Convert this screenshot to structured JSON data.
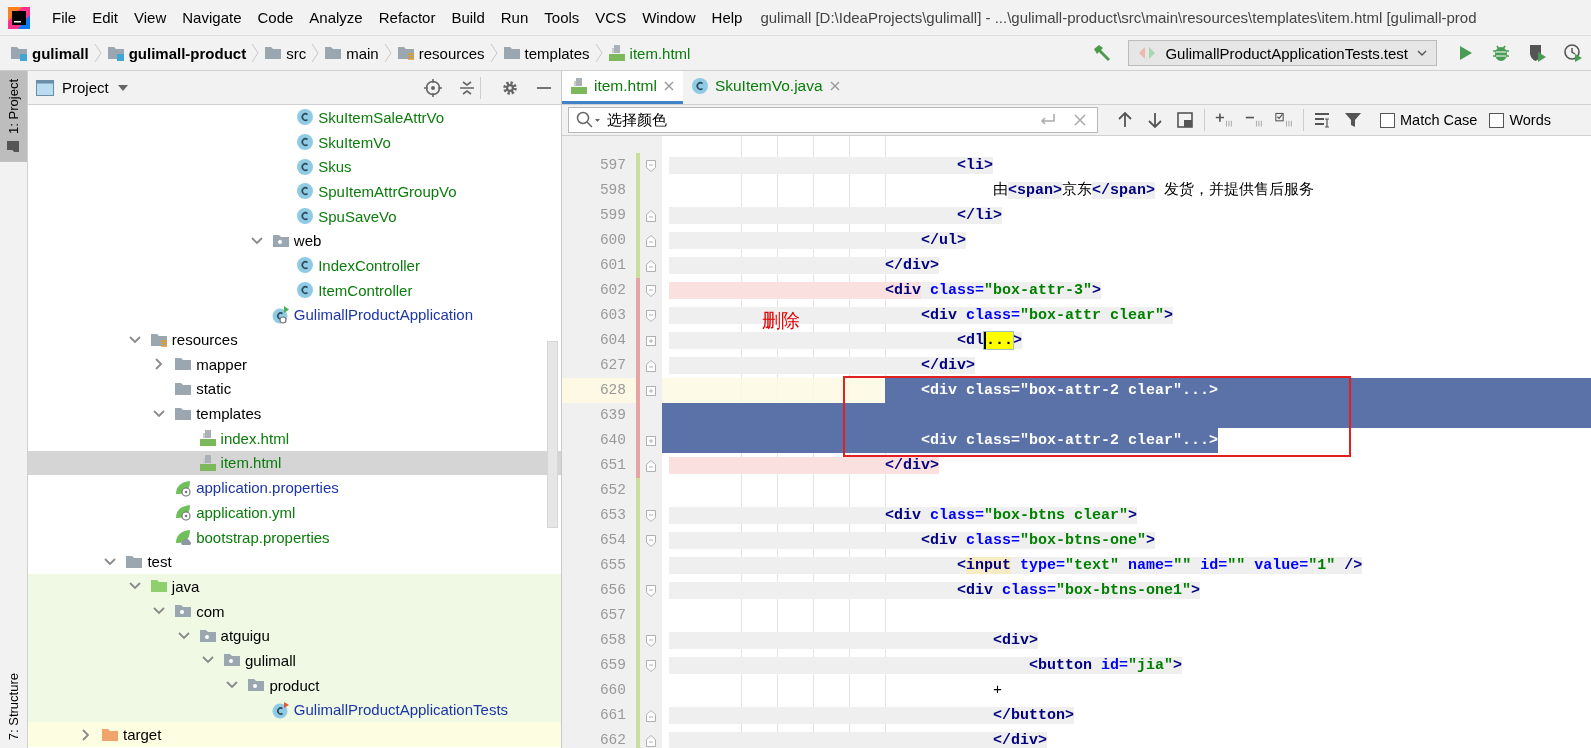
{
  "menu": {
    "items": [
      "File",
      "Edit",
      "View",
      "Navigate",
      "Code",
      "Analyze",
      "Refactor",
      "Build",
      "Run",
      "Tools",
      "VCS",
      "Window",
      "Help"
    ],
    "title": "gulimall [D:\\IdeaProjects\\gulimall] - ...\\gulimall-product\\src\\main\\resources\\templates\\item.html [gulimall-prod"
  },
  "breadcrumb": [
    {
      "label": "gulimall",
      "kind": "module"
    },
    {
      "label": "gulimall-product",
      "kind": "module"
    },
    {
      "label": "src",
      "kind": "folder"
    },
    {
      "label": "main",
      "kind": "folder"
    },
    {
      "label": "resources",
      "kind": "resources"
    },
    {
      "label": "templates",
      "kind": "folder"
    },
    {
      "label": "item.html",
      "kind": "html"
    }
  ],
  "run_config": {
    "label": "GulimallProductApplicationTests.test"
  },
  "side_tabs": [
    {
      "label": "1: Project",
      "selected": true
    },
    {
      "label": "7: Structure",
      "selected": false
    }
  ],
  "project": {
    "title": "Project",
    "tree": [
      {
        "children": [
          {
            "children": [
              {
                "children": [
                  {
                    "children": [
                      {
                        "children": [
                          {
                            "children": [
                              {
                                "children": [
                                  {
                                    "children": [
                                      {
                                        "label": "SkuItemSaleAttrVo",
                                        "kind": "class",
                                        "color": "#0a7c0a",
                                        "selected": false
                                      },
                                      {
                                        "label": "SkuItemVo",
                                        "kind": "class",
                                        "color": "#0a7c0a",
                                        "selected": false
                                      },
                                      {
                                        "label": "Skus",
                                        "kind": "class",
                                        "color": "#0a7c0a",
                                        "selected": false
                                      },
                                      {
                                        "label": "SpuItemAttrGroupVo",
                                        "kind": "class",
                                        "color": "#0a7c0a",
                                        "selected": false
                                      },
                                      {
                                        "label": "SpuSaveVo",
                                        "kind": "class",
                                        "color": "#0a7c0a",
                                        "selected": false
                                      }
                                    ]
                                  },
                                  {
                                    "label": "web",
                                    "kind": "package",
                                    "selected": false,
                                    "expanded": true,
                                    "children": [
                                      {
                                        "label": "IndexController",
                                        "kind": "class",
                                        "color": "#0a7c0a",
                                        "selected": false
                                      },
                                      {
                                        "label": "ItemController",
                                        "kind": "class",
                                        "color": "#0a7c0a",
                                        "selected": false
                                      }
                                    ]
                                  },
                                  {
                                    "label": "GulimallProductApplication",
                                    "kind": "spring-app",
                                    "color": "#1c36a8",
                                    "selected": false
                                  }
                                ]
                              }
                            ]
                          }
                        ]
                      }
                    ]
                  }
                ]
              },
              {
                "label": "resources",
                "kind": "resources",
                "selected": false,
                "expanded": true,
                "children": [
                  {
                    "label": "mapper",
                    "kind": "folder",
                    "selected": false,
                    "expanded": false
                  },
                  {
                    "label": "static",
                    "kind": "folder",
                    "selected": false
                  },
                  {
                    "label": "templates",
                    "kind": "folder",
                    "selected": false,
                    "expanded": true,
                    "children": [
                      {
                        "label": "index.html",
                        "kind": "html",
                        "color": "#0a7c0a",
                        "selected": false
                      },
                      {
                        "label": "item.html",
                        "kind": "html",
                        "color": "#0a7c0a",
                        "selected": true
                      }
                    ]
                  },
                  {
                    "label": "application.properties",
                    "kind": "spring-config",
                    "color": "#1c36a8",
                    "selected": false
                  },
                  {
                    "label": "application.yml",
                    "kind": "spring-config",
                    "color": "#0a7c0a",
                    "selected": false
                  },
                  {
                    "label": "bootstrap.properties",
                    "kind": "spring-cloud",
                    "color": "#0a7c0a",
                    "selected": false
                  }
                ]
              }
            ]
          },
          {
            "label": "test",
            "kind": "folder",
            "selected": false,
            "expanded": true,
            "children": [
              {
                "label": "java",
                "kind": "test-root",
                "selected": false,
                "expanded": true,
                "children": [
                  {
                    "label": "com",
                    "kind": "package",
                    "selected": false,
                    "expanded": true,
                    "children": [
                      {
                        "label": "atguigu",
                        "kind": "package",
                        "selected": false,
                        "expanded": true,
                        "children": [
                          {
                            "label": "gulimall",
                            "kind": "package",
                            "selected": false,
                            "expanded": true,
                            "children": [
                              {
                                "label": "product",
                                "kind": "package",
                                "selected": false,
                                "expanded": true,
                                "children": [
                                  {
                                    "label": "GulimallProductApplicationTests",
                                    "kind": "test-class",
                                    "color": "#1c36a8",
                                    "selected": false
                                  }
                                ]
                              }
                            ]
                          }
                        ]
                      }
                    ]
                  }
                ]
              }
            ]
          }
        ]
      },
      {
        "label": "target",
        "kind": "excluded",
        "selected": false,
        "expanded": false
      }
    ]
  },
  "editor": {
    "tabs": [
      {
        "label": "item.html",
        "kind": "html",
        "selected": true
      },
      {
        "label": "SkuItemVo.java",
        "kind": "class",
        "selected": false
      }
    ],
    "find": {
      "value": "选择颜色",
      "options": [
        {
          "label": "Match Case",
          "checked": false
        },
        {
          "label": "Words",
          "checked": false
        }
      ]
    },
    "annotation": "删除",
    "lines": [
      {
        "number": "597",
        "changed": false,
        "fold": {
          "kind": "start"
        },
        "current": false,
        "caret": false,
        "selected": false,
        "highlighted": true,
        "tokens": [
          {
            "kind": "tag",
            "text": "                                <li>"
          }
        ]
      },
      {
        "number": "598",
        "changed": false,
        "current": false,
        "caret": false,
        "selected": false,
        "highlighted": true,
        "tokens": [
          {
            "kind": "text",
            "text": "                                    由"
          },
          {
            "kind": "tag",
            "text": "<span>"
          },
          {
            "kind": "text",
            "text": "京东"
          },
          {
            "kind": "tag",
            "text": "</span>"
          },
          {
            "kind": "text",
            "text": " 发货，并提供售后服务"
          }
        ]
      },
      {
        "number": "599",
        "changed": false,
        "fold": {
          "kind": "end"
        },
        "current": false,
        "caret": false,
        "selected": false,
        "highlighted": true,
        "tokens": [
          {
            "kind": "tag",
            "text": "                                </li>"
          }
        ]
      },
      {
        "number": "600",
        "changed": false,
        "fold": {
          "kind": "end"
        },
        "current": false,
        "caret": false,
        "selected": false,
        "highlighted": true,
        "tokens": [
          {
            "kind": "tag",
            "text": "                            </ul>"
          }
        ]
      },
      {
        "number": "601",
        "changed": false,
        "fold": {
          "kind": "end"
        },
        "current": false,
        "caret": false,
        "selected": false,
        "highlighted": true,
        "tokens": [
          {
            "kind": "tag",
            "text": "                        </div>"
          }
        ]
      },
      {
        "number": "602",
        "changed": true,
        "fold": {
          "kind": "start"
        },
        "current": false,
        "caret": false,
        "selected": false,
        "highlighted": true,
        "tokens": [
          {
            "kind": "matched-tag",
            "text": "                        <div"
          },
          {
            "kind": "attr",
            "text": " class="
          },
          {
            "kind": "value",
            "text": "\"box-attr-3\""
          },
          {
            "kind": "tag",
            "text": ">"
          }
        ]
      },
      {
        "number": "603",
        "changed": true,
        "fold": {
          "kind": "start"
        },
        "current": false,
        "caret": false,
        "selected": false,
        "highlighted": true,
        "tokens": [
          {
            "kind": "tag",
            "text": "                            <div"
          },
          {
            "kind": "attr",
            "text": " class="
          },
          {
            "kind": "value",
            "text": "\"box-attr clear\""
          },
          {
            "kind": "tag",
            "text": ">"
          }
        ]
      },
      {
        "number": "604",
        "changed": true,
        "fold": {
          "kind": "collapsed"
        },
        "current": false,
        "caret": true,
        "selected": false,
        "highlighted": true,
        "tokens": [
          {
            "kind": "tag",
            "text": "                                <dl"
          },
          {
            "kind": "folded",
            "text": "..."
          },
          {
            "kind": "tag",
            "text": ">"
          }
        ]
      },
      {
        "number": "627",
        "changed": true,
        "fold": {
          "kind": "end"
        },
        "current": false,
        "caret": false,
        "selected": false,
        "highlighted": true,
        "tokens": [
          {
            "kind": "tag",
            "text": "                            </div>"
          }
        ]
      },
      {
        "number": "628",
        "changed": true,
        "fold": {
          "kind": "collapsed"
        },
        "current": true,
        "caret": false,
        "selected": true,
        "highlighted": false,
        "tokens": [
          {
            "kind": "tag",
            "text": "                            <div"
          },
          {
            "kind": "attr",
            "text": " class="
          },
          {
            "kind": "value",
            "text": "\"box-attr-2 clear\""
          },
          {
            "kind": "folded",
            "text": "..."
          },
          {
            "kind": "tag",
            "text": ">"
          }
        ]
      },
      {
        "number": "639",
        "changed": true,
        "current": false,
        "selected": true
      },
      {
        "number": "640",
        "changed": true,
        "fold": {
          "kind": "collapsed"
        },
        "current": false,
        "caret": false,
        "selected": true,
        "highlighted": false,
        "tokens": [
          {
            "kind": "tag",
            "text": "                            <div"
          },
          {
            "kind": "attr",
            "text": " class="
          },
          {
            "kind": "value",
            "text": "\"box-attr-2 clear\""
          },
          {
            "kind": "folded",
            "text": "..."
          },
          {
            "kind": "tag",
            "text": ">"
          }
        ]
      },
      {
        "number": "651",
        "changed": true,
        "fold": {
          "kind": "end"
        },
        "current": false,
        "caret": false,
        "selected": false,
        "highlighted": false,
        "tokens": [
          {
            "kind": "matched-tag",
            "text": "                        </div>"
          }
        ]
      },
      {
        "number": "652",
        "changed": false,
        "current": false,
        "selected": false
      },
      {
        "number": "653",
        "changed": false,
        "fold": {
          "kind": "start"
        },
        "current": false,
        "caret": false,
        "selected": false,
        "highlighted": true,
        "tokens": [
          {
            "kind": "tag",
            "text": "                        <div"
          },
          {
            "kind": "attr",
            "text": " class="
          },
          {
            "kind": "value",
            "text": "\"box-btns clear\""
          },
          {
            "kind": "tag",
            "text": ">"
          }
        ]
      },
      {
        "number": "654",
        "changed": false,
        "fold": {
          "kind": "start"
        },
        "current": false,
        "caret": false,
        "selected": false,
        "highlighted": true,
        "tokens": [
          {
            "kind": "tag",
            "text": "                            <div"
          },
          {
            "kind": "attr",
            "text": " class="
          },
          {
            "kind": "value",
            "text": "\"box-btns-one\""
          },
          {
            "kind": "tag",
            "text": ">"
          }
        ]
      },
      {
        "number": "655",
        "changed": false,
        "current": false,
        "caret": false,
        "selected": false,
        "highlighted": true,
        "tokens": [
          {
            "kind": "tag",
            "text": "                                <"
          },
          {
            "kind": "warning-tag",
            "text": "input"
          },
          {
            "kind": "attr",
            "text": " type="
          },
          {
            "kind": "value",
            "text": "\"text\""
          },
          {
            "kind": "attr",
            "text": " name="
          },
          {
            "kind": "value",
            "text": "\"\""
          },
          {
            "kind": "attr",
            "text": " id="
          },
          {
            "kind": "value",
            "text": "\"\""
          },
          {
            "kind": "attr",
            "text": " value="
          },
          {
            "kind": "value",
            "text": "\"1\""
          },
          {
            "kind": "tag",
            "text": " />"
          }
        ]
      },
      {
        "number": "656",
        "changed": false,
        "fold": {
          "kind": "start"
        },
        "current": false,
        "caret": false,
        "selected": false,
        "highlighted": true,
        "tokens": [
          {
            "kind": "tag",
            "text": "                                <div"
          },
          {
            "kind": "attr",
            "text": " class="
          },
          {
            "kind": "value",
            "text": "\"box-btns-one1\""
          },
          {
            "kind": "tag",
            "text": ">"
          }
        ]
      },
      {
        "number": "657",
        "changed": false,
        "current": false,
        "selected": false
      },
      {
        "number": "658",
        "changed": false,
        "fold": {
          "kind": "start"
        },
        "current": false,
        "caret": false,
        "selected": false,
        "highlighted": true,
        "tokens": [
          {
            "kind": "tag",
            "text": "                                    <div>"
          }
        ]
      },
      {
        "number": "659",
        "changed": false,
        "fold": {
          "kind": "start"
        },
        "current": false,
        "caret": false,
        "selected": false,
        "highlighted": true,
        "tokens": [
          {
            "kind": "tag",
            "text": "                                        <button"
          },
          {
            "kind": "attr",
            "text": " id="
          },
          {
            "kind": "value",
            "text": "\"jia\""
          },
          {
            "kind": "tag",
            "text": ">"
          }
        ]
      },
      {
        "number": "660",
        "changed": false,
        "current": false,
        "caret": false,
        "selected": false,
        "tokens": [
          {
            "kind": "text",
            "text": "                                    +"
          }
        ]
      },
      {
        "number": "661",
        "changed": false,
        "fold": {
          "kind": "end"
        },
        "current": false,
        "caret": false,
        "selected": false,
        "highlighted": true,
        "tokens": [
          {
            "kind": "tag",
            "text": "                                    </button>"
          }
        ]
      },
      {
        "number": "662",
        "changed": false,
        "fold": {
          "kind": "end"
        },
        "current": false,
        "caret": false,
        "selected": false,
        "highlighted": true,
        "tokens": [
          {
            "kind": "tag",
            "text": "                                    </div>"
          }
        ]
      }
    ]
  }
}
